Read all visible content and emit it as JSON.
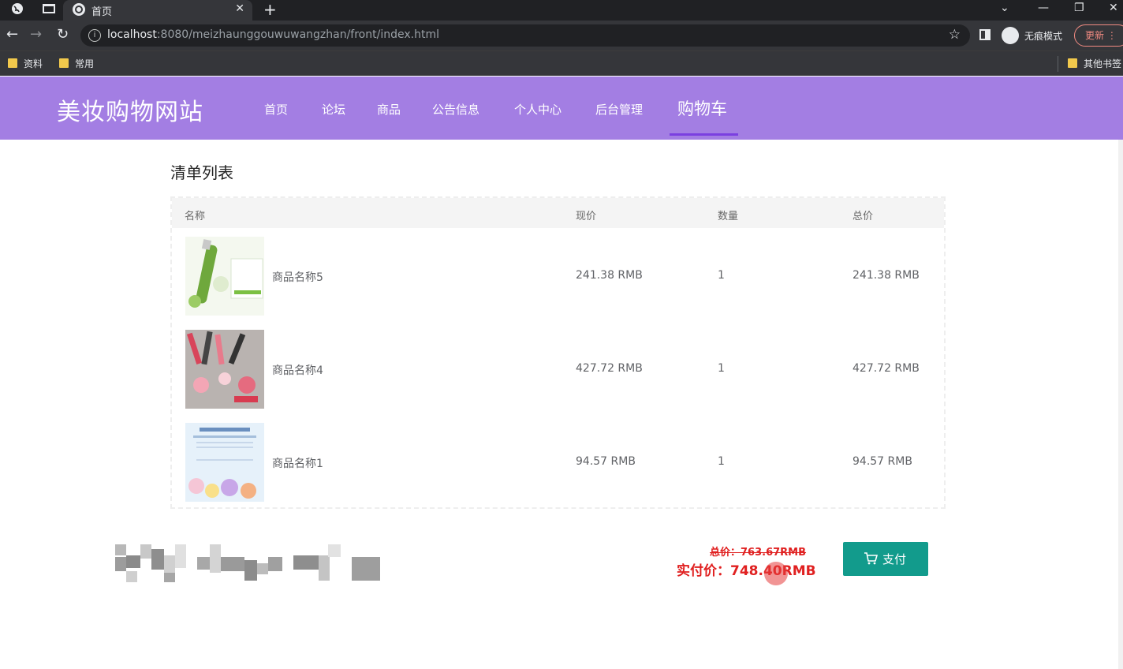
{
  "browser": {
    "tab_title": "首页",
    "tab_close": "✕",
    "new_tab": "+",
    "url_host": "localhost",
    "url_rest": ":8080/meizhaunggouwuwangzhan/front/index.html",
    "incognito_label": "无痕模式",
    "update_label": "更新",
    "bookmarks": [
      "资料",
      "常用"
    ],
    "other_bookmarks": "其他书签"
  },
  "site": {
    "title": "美妆购物网站",
    "nav": [
      "首页",
      "论坛",
      "商品",
      "公告信息",
      "个人中心",
      "后台管理",
      "购物车"
    ],
    "active_nav": "购物车",
    "accent_color": "#a37ee3"
  },
  "cart": {
    "section_title": "清单列表",
    "headers": {
      "name": "名称",
      "price": "现价",
      "qty": "数量",
      "total": "总价"
    },
    "items": [
      {
        "name": "商品名称5",
        "price": "241.38 RMB",
        "qty": "1",
        "total": "241.38 RMB"
      },
      {
        "name": "商品名称4",
        "price": "427.72 RMB",
        "qty": "1",
        "total": "427.72 RMB"
      },
      {
        "name": "商品名称1",
        "price": "94.57 RMB",
        "qty": "1",
        "total": "94.57 RMB"
      }
    ]
  },
  "summary": {
    "original_total": "总价：763.67RMB",
    "actual_total": "实付价：748.40RMB",
    "pay_label": "支付",
    "pay_color": "#129b8c"
  }
}
